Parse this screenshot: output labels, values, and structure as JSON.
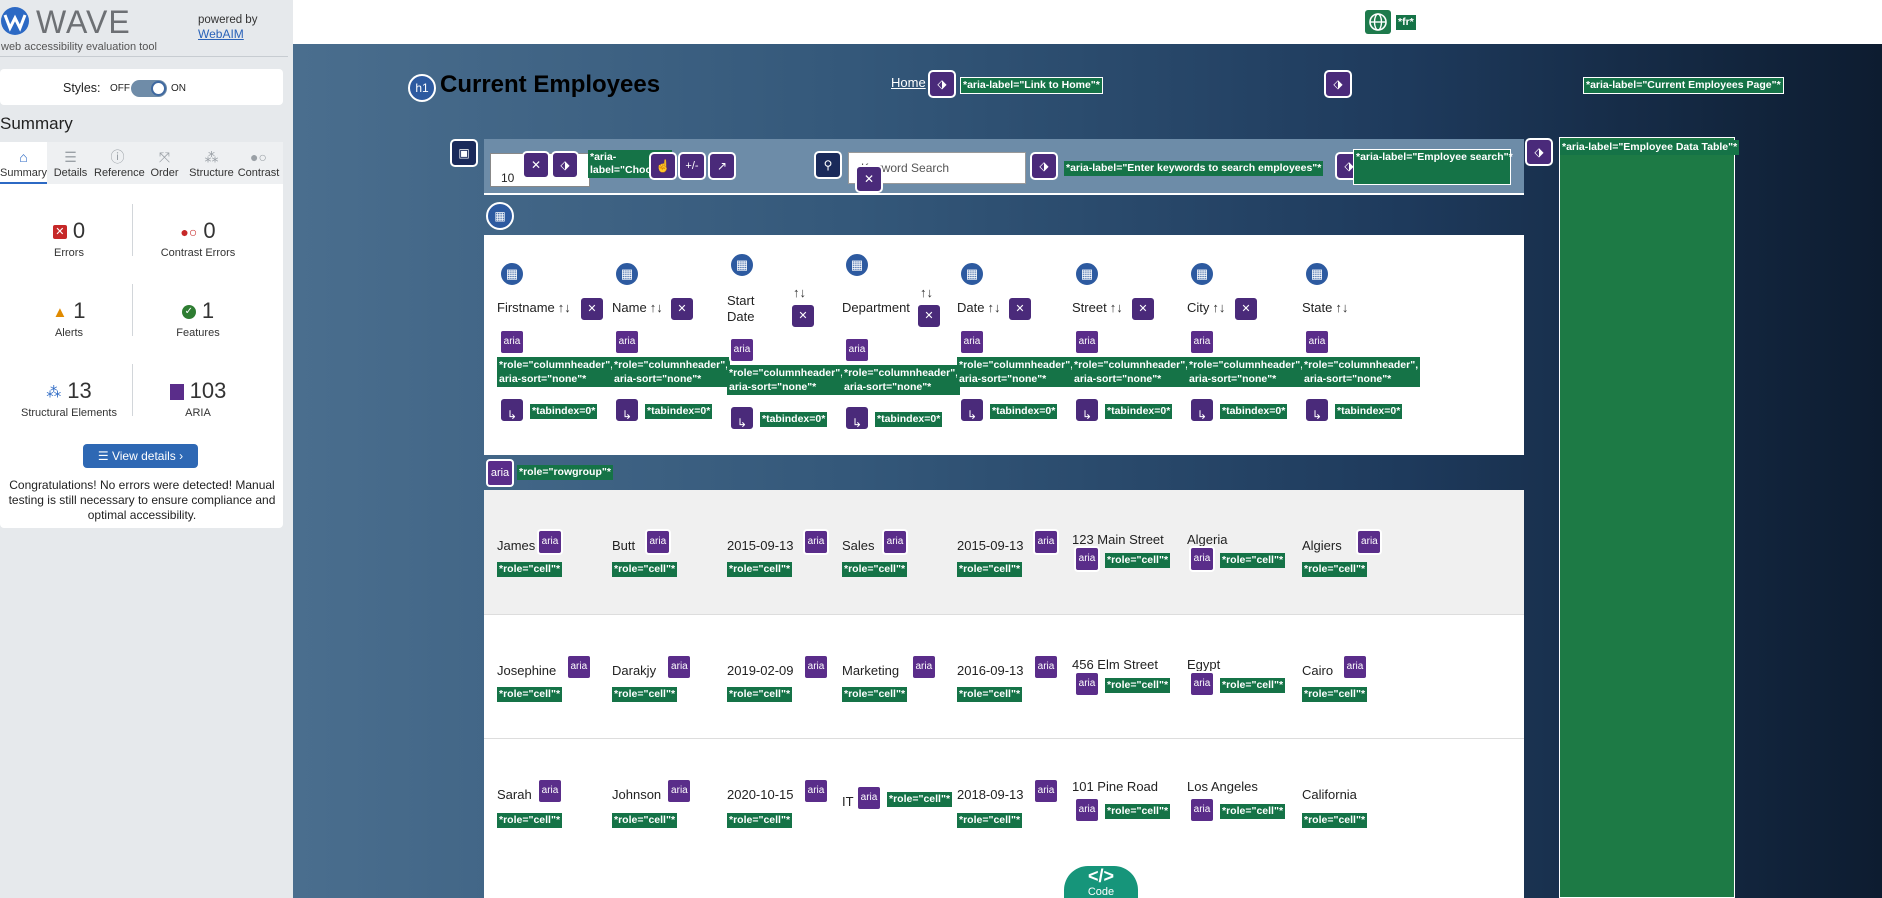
{
  "wave": {
    "logo_text": "WAVE",
    "tagline": "web accessibility evaluation tool",
    "powered_by": "powered by",
    "webaim_link": "WebAIM",
    "styles_label": "Styles:",
    "toggle_off": "OFF",
    "toggle_on": "ON",
    "summary_title": "Summary",
    "tabs": [
      "Summary",
      "Details",
      "Reference",
      "Order",
      "Structure",
      "Contrast"
    ],
    "stats": {
      "errors": {
        "count": "0",
        "label": "Errors"
      },
      "contrast": {
        "count": "0",
        "label": "Contrast Errors"
      },
      "alerts": {
        "count": "1",
        "label": "Alerts"
      },
      "features": {
        "count": "1",
        "label": "Features"
      },
      "structural": {
        "count": "13",
        "label": "Structural Elements"
      },
      "aria": {
        "count": "103",
        "label": "ARIA"
      }
    },
    "view_details": "View details ›",
    "congrats": "Congratulations! No errors were detected! Manual testing is still necessary to ensure compliance and optimal accessibility.",
    "colors": {
      "accent": "#2e68b4",
      "error": "#c62828",
      "alert": "#e08a00",
      "feature": "#2e7d32",
      "aria": "#5a2d8a"
    }
  },
  "page": {
    "lang_label": "*fr*",
    "title": "Current Employees",
    "h1_badge": "h1",
    "home_link": "Home",
    "ann_home": "*aria-label=\"Link to Home\"*",
    "ann_page": "*aria-label=\"Current Employees Page\"*",
    "length_value": "10",
    "ann_choose_1": "*aria-",
    "ann_choose_2": "label=\"Choo",
    "plusminus": "+/-",
    "search_placeholder": "Keyword Search",
    "ann_search_input": "*aria-label=\"Enter keywords to search employees\"*",
    "ann_search_1": "*aria-label=\"Employee search\"*",
    "ann_table": "*aria-label=\"Employee Data Table\"*",
    "ann_rowgroup": "*role=\"rowgroup\"*",
    "aria_badge": "aria",
    "ann_cell": "*role=\"cell\"*",
    "ann_colheader_1": "*role=\"columnheader\",",
    "ann_colheader_2": "aria-sort=\"none\"*",
    "ann_tabindex": "*tabindex=0*",
    "code_label": "Code",
    "code_glyph": "</>"
  },
  "table": {
    "headers": [
      "Firstname",
      "Name",
      "Start Date",
      "Department",
      "Date",
      "Street",
      "City",
      "State"
    ],
    "start_date_lines": [
      "Start",
      "Date"
    ],
    "sort_glyph": "↑↓",
    "rows": [
      [
        "James",
        "Butt",
        "2015-09-13",
        "Sales",
        "2015-09-13",
        "123 Main Street",
        "Algeria",
        "Algiers"
      ],
      [
        "Josephine",
        "Darakjy",
        "2019-02-09",
        "Marketing",
        "2016-09-13",
        "456 Elm Street",
        "Egypt",
        "Cairo"
      ],
      [
        "Sarah",
        "Johnson",
        "2020-10-15",
        "IT",
        "2018-09-13",
        "101 Pine Road",
        "Los Angeles",
        "California"
      ]
    ]
  }
}
